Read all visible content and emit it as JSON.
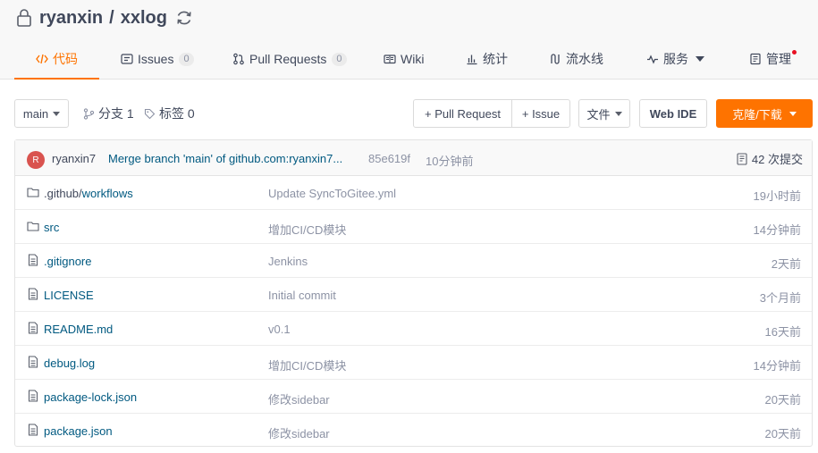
{
  "repo": {
    "owner": "ryanxin",
    "separator": "/",
    "name": "xxlog"
  },
  "tabs": [
    {
      "label": "代码",
      "icon": "code-icon"
    },
    {
      "label": "Issues",
      "count": "0",
      "icon": "issues-icon"
    },
    {
      "label": "Pull Requests",
      "count": "0",
      "icon": "pull-request-icon"
    },
    {
      "label": "Wiki",
      "icon": "wiki-icon"
    },
    {
      "label": "统计",
      "icon": "stats-icon"
    },
    {
      "label": "流水线",
      "icon": "pipeline-icon"
    },
    {
      "label": "服务",
      "icon": "service-icon"
    },
    {
      "label": "管理",
      "icon": "manage-icon"
    }
  ],
  "toolbar": {
    "branch": "main",
    "branches": "分支 1",
    "tags": "标签 0",
    "pull_request": "+ Pull Request",
    "issue": "+ Issue",
    "files": "文件",
    "web_ide": "Web IDE",
    "clone": "克隆/下载"
  },
  "commit": {
    "avatar_letter": "R",
    "author": "ryanxin7",
    "message": "Merge branch 'main' of github.com:ryanxin7...",
    "sha": "85e619f",
    "time": "10分钟前",
    "count": "42 次提交"
  },
  "files": [
    {
      "type": "folder",
      "name_prefix": ".github/",
      "name": "workflows",
      "message": "Update SyncToGitee.yml",
      "time": "19小时前"
    },
    {
      "type": "folder",
      "name_prefix": "",
      "name": "src",
      "message": "增加CI/CD模块",
      "time": "14分钟前"
    },
    {
      "type": "file",
      "name_prefix": "",
      "name": ".gitignore",
      "message": "Jenkins",
      "time": "2天前"
    },
    {
      "type": "file",
      "name_prefix": "",
      "name": "LICENSE",
      "message": "Initial commit",
      "time": "3个月前"
    },
    {
      "type": "file",
      "name_prefix": "",
      "name": "README.md",
      "message": "v0.1",
      "time": "16天前"
    },
    {
      "type": "file",
      "name_prefix": "",
      "name": "debug.log",
      "message": "增加CI/CD模块",
      "time": "14分钟前"
    },
    {
      "type": "file",
      "name_prefix": "",
      "name": "package-lock.json",
      "message": "修改sidebar",
      "time": "20天前"
    },
    {
      "type": "file",
      "name_prefix": "",
      "name": "package.json",
      "message": "修改sidebar",
      "time": "20天前"
    }
  ],
  "colors": {
    "accent": "#fe7300",
    "link": "#005980",
    "muted": "#8c92a4",
    "text": "#40485b"
  }
}
